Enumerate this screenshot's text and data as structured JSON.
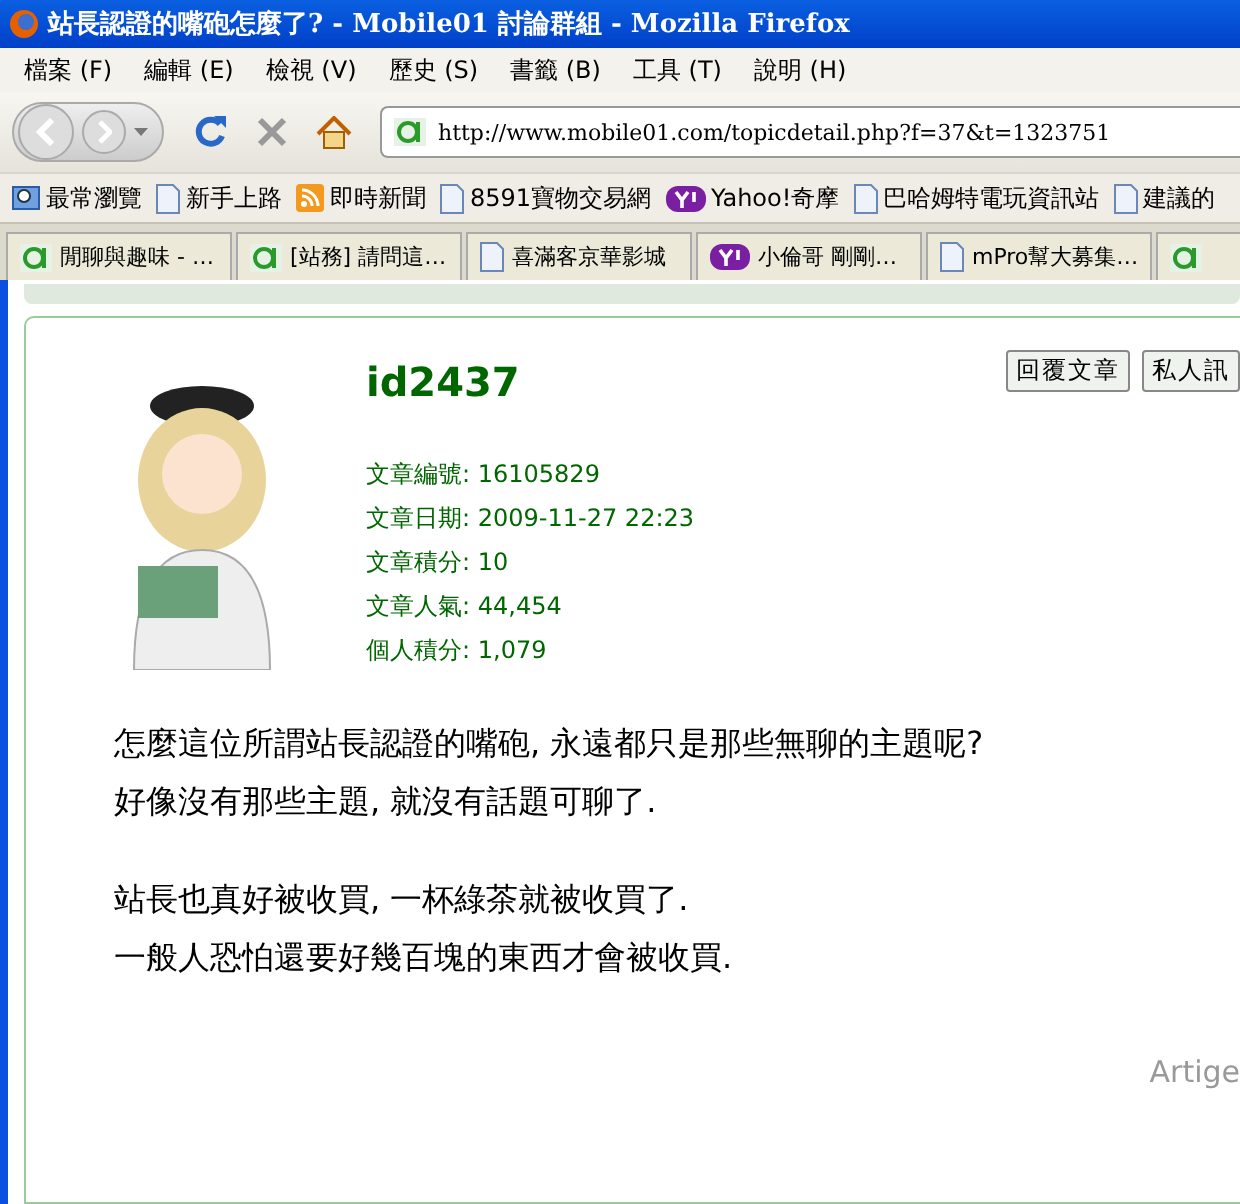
{
  "window": {
    "title": "站長認證的嘴砲怎麼了? - Mobile01 討論群組 - Mozilla Firefox"
  },
  "menu": [
    "檔案 (F)",
    "編輯 (E)",
    "檢視 (V)",
    "歷史 (S)",
    "書籤 (B)",
    "工具 (T)",
    "說明 (H)"
  ],
  "address": {
    "value": "http://www.mobile01.com/topicdetail.php?f=37&t=1323751"
  },
  "bookmarks": [
    {
      "kind": "search",
      "label": "最常瀏覽"
    },
    {
      "kind": "page",
      "label": "新手上路"
    },
    {
      "kind": "rss",
      "label": "即時新聞"
    },
    {
      "kind": "page",
      "label": "8591寶物交易網"
    },
    {
      "kind": "yahoo",
      "label": "Yahoo!奇摩"
    },
    {
      "kind": "page",
      "label": "巴哈姆特電玩資訊站"
    },
    {
      "kind": "page",
      "label": "建議的"
    }
  ],
  "tabs": [
    {
      "kind": "site",
      "label": "閒聊與趣味 - …",
      "selected": false
    },
    {
      "kind": "site",
      "label": "[站務] 請問這…",
      "selected": false
    },
    {
      "kind": "page",
      "label": "喜滿客京華影城",
      "selected": false
    },
    {
      "kind": "yahoo",
      "label": "小倫哥 剛剛…",
      "selected": false
    },
    {
      "kind": "page",
      "label": "mPro幫大募集…",
      "selected": false
    },
    {
      "kind": "site",
      "selected": false
    }
  ],
  "post": {
    "username": "id2437",
    "buttons": [
      "回覆文章",
      "私人訊"
    ],
    "info": [
      {
        "label": "文章編號:",
        "value": "16105829"
      },
      {
        "label": "文章日期:",
        "value": "2009-11-27 22:23"
      },
      {
        "label": "文章積分:",
        "value": "10"
      },
      {
        "label": "文章人氣:",
        "value": "44,454"
      },
      {
        "label": "個人積分:",
        "value": "1,079"
      }
    ],
    "paragraphs": [
      [
        "怎麼這位所謂站長認證的嘴砲, 永遠都只是那些無聊的主題呢?",
        "好像沒有那些主題, 就沒有話題可聊了."
      ],
      [
        "站長也真好被收買, 一杯綠茶就被收買了.",
        "一般人恐怕還要好幾百塊的東西才會被收買."
      ]
    ],
    "footer": "Artige"
  }
}
